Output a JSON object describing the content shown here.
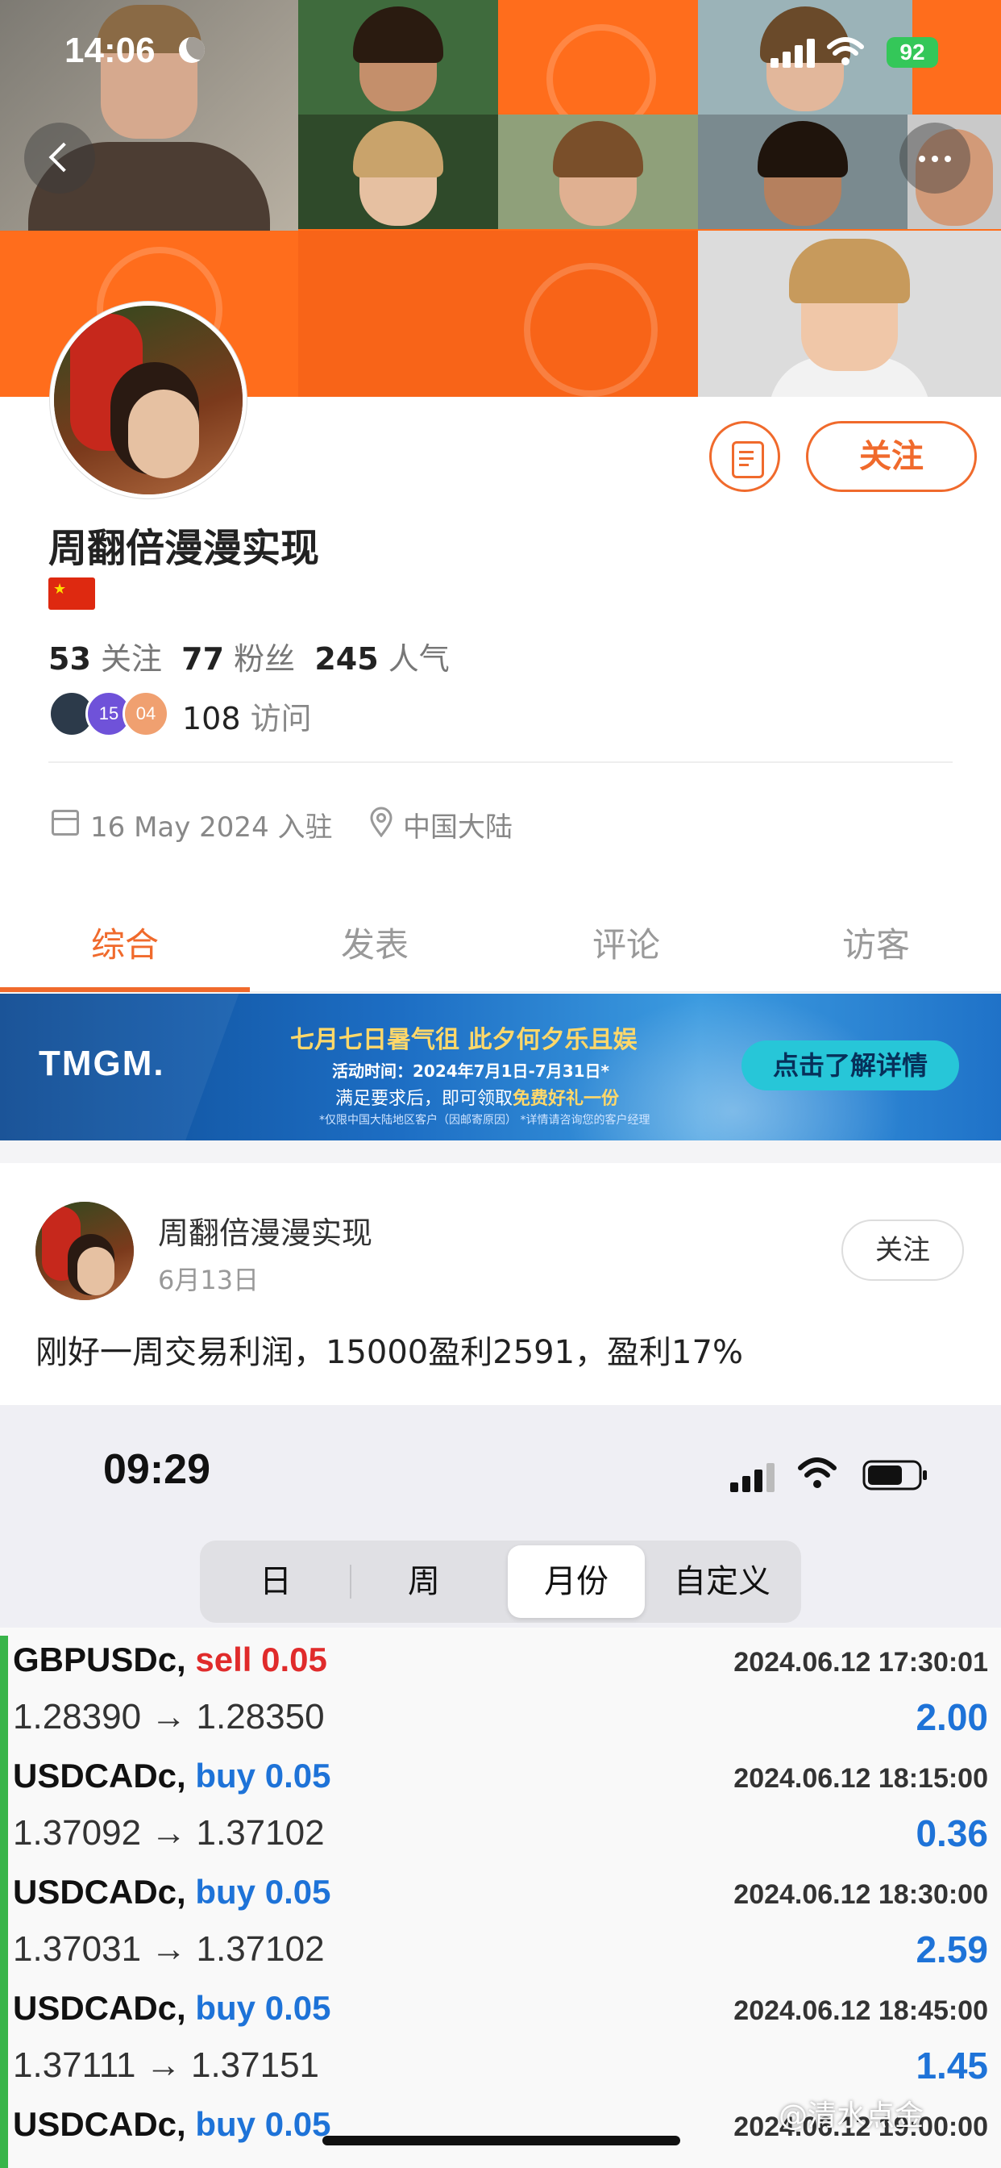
{
  "status_bar": {
    "time": "14:06",
    "battery": "92"
  },
  "profile": {
    "username": "周翻倍漫漫实现",
    "follow_label": "关注",
    "stats": {
      "following_count": "53",
      "following_label": "关注",
      "followers_count": "77",
      "followers_label": "粉丝",
      "popularity_count": "245",
      "popularity_label": "人气"
    },
    "visitor_badges": [
      "15",
      "04"
    ],
    "visits_count": "108",
    "visits_label": "访问",
    "join_date": "16 May 2024 入驻",
    "location": "中国大陆"
  },
  "tabs": [
    {
      "label": "综合",
      "active": true
    },
    {
      "label": "发表",
      "active": false
    },
    {
      "label": "评论",
      "active": false
    },
    {
      "label": "访客",
      "active": false
    }
  ],
  "banner": {
    "logo": "TMGM.",
    "title": "七月七日暑气徂  此夕何夕乐且娱",
    "date": "活动时间：2024年7月1日-7月31日*",
    "sub_prefix": "满足要求后，即可领取",
    "sub_highlight": "免费好礼一份",
    "note": "*仅限中国大陆地区客户（因邮寄原因） *详情请咨询您的客户经理",
    "cta": "点击了解详情"
  },
  "post": {
    "author": "周翻倍漫漫实现",
    "date": "6月13日",
    "follow_label": "关注",
    "text": "刚好一周交易利润，15000盈利2591，盈利17%"
  },
  "embedded_screenshot": {
    "time": "09:29",
    "segments": [
      {
        "label": "日",
        "active": false
      },
      {
        "label": "周",
        "active": false
      },
      {
        "label": "月份",
        "active": true
      },
      {
        "label": "自定义",
        "active": false
      }
    ],
    "trades": [
      {
        "symbol": "GBPUSDc,",
        "side": "sell",
        "lots": "0.05",
        "timestamp": "2024.06.12 17:30:01",
        "prices": "1.28390 → 1.28350",
        "profit": "2.00"
      },
      {
        "symbol": "USDCADc,",
        "side": "buy",
        "lots": "0.05",
        "timestamp": "2024.06.12 18:15:00",
        "prices": "1.37092 → 1.37102",
        "profit": "0.36"
      },
      {
        "symbol": "USDCADc,",
        "side": "buy",
        "lots": "0.05",
        "timestamp": "2024.06.12 18:30:00",
        "prices": "1.37031 → 1.37102",
        "profit": "2.59"
      },
      {
        "symbol": "USDCADc,",
        "side": "buy",
        "lots": "0.05",
        "timestamp": "2024.06.12 18:45:00",
        "prices": "1.37111 → 1.37151",
        "profit": "1.45"
      },
      {
        "symbol": "USDCADc,",
        "side": "buy",
        "lots": "0.05",
        "timestamp": "2024.06.12 19:00:00",
        "prices": "",
        "profit": ""
      }
    ]
  },
  "watermark": "@清水点金",
  "colors": {
    "accent": "#f06a2c",
    "cover_orange": "#ff6d1c",
    "sell": "#e02b2b",
    "buy": "#1e73d8",
    "profit_bar": "#39b54a"
  }
}
